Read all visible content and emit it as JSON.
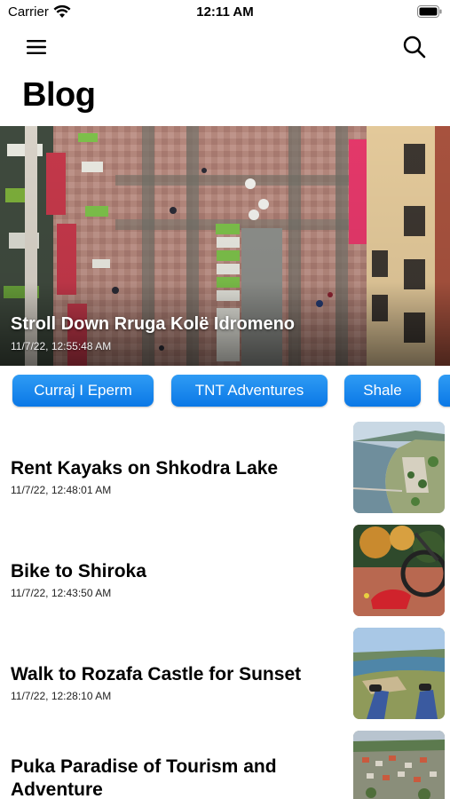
{
  "status_bar": {
    "carrier": "Carrier",
    "time": "12:11 AM"
  },
  "nav": {
    "menu_icon": "hamburger-menu-icon",
    "search_icon": "search-icon"
  },
  "page_title": "Blog",
  "hero": {
    "title": "Stroll Down Rruga Kolë Idromeno",
    "date": "11/7/22, 12:55:48 AM"
  },
  "categories": [
    "Curraj I Eperm",
    "TNT Adventures",
    "Shale",
    ""
  ],
  "posts": [
    {
      "title": "Rent Kayaks on Shkodra Lake",
      "date": "11/7/22, 12:48:01 AM"
    },
    {
      "title": "Bike to Shiroka",
      "date": "11/7/22, 12:43:50 AM"
    },
    {
      "title": "Walk to Rozafa Castle for Sunset",
      "date": "11/7/22, 12:28:10 AM"
    },
    {
      "title": "Puka Paradise of Tourism and Adventure",
      "date": ""
    }
  ],
  "colors": {
    "chip": "#1a86ee",
    "text": "#000000",
    "background": "#ffffff"
  }
}
